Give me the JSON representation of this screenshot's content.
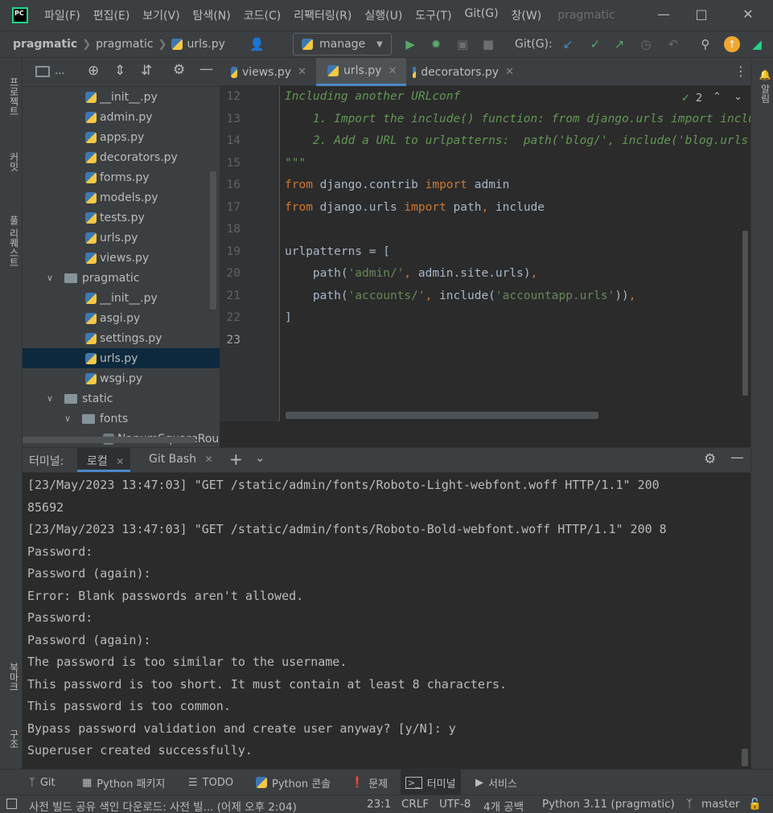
{
  "app": {
    "logo": "PC",
    "menu": [
      "파일(F)",
      "편집(E)",
      "보기(V)",
      "탐색(N)",
      "코드(C)",
      "리팩터링(R)",
      "실행(U)",
      "도구(T)",
      "Git(G)",
      "창(W)"
    ],
    "window_title": "pragmatic"
  },
  "navbar": {
    "crumbs": [
      "pragmatic",
      "pragmatic",
      "urls.py"
    ],
    "run_config": "manage",
    "git_label": "Git(G):"
  },
  "left_strip": {
    "project": "프로젝트",
    "commit": "커밋",
    "pull_requests": "풀 리퀘스트",
    "bookmarks": "북마크",
    "structure": "구조"
  },
  "right_strip": {
    "notifications": "알림"
  },
  "project_tree": {
    "toolbar_label": "...",
    "rows": [
      {
        "label": "__init__.py",
        "type": "py",
        "indent": 1
      },
      {
        "label": "admin.py",
        "type": "py",
        "indent": 1
      },
      {
        "label": "apps.py",
        "type": "py",
        "indent": 1
      },
      {
        "label": "decorators.py",
        "type": "py",
        "indent": 1
      },
      {
        "label": "forms.py",
        "type": "py",
        "indent": 1
      },
      {
        "label": "models.py",
        "type": "py",
        "indent": 1
      },
      {
        "label": "tests.py",
        "type": "py",
        "indent": 1
      },
      {
        "label": "urls.py",
        "type": "py",
        "indent": 1
      },
      {
        "label": "views.py",
        "type": "py",
        "indent": 1
      },
      {
        "label": "pragmatic",
        "type": "folder",
        "indent": 0
      },
      {
        "label": "__init__.py",
        "type": "py",
        "indent": 1
      },
      {
        "label": "asgi.py",
        "type": "py",
        "indent": 1
      },
      {
        "label": "settings.py",
        "type": "py",
        "indent": 1
      },
      {
        "label": "urls.py",
        "type": "py",
        "indent": 1,
        "selected": true
      },
      {
        "label": "wsgi.py",
        "type": "py",
        "indent": 1
      },
      {
        "label": "static",
        "type": "folder",
        "indent": 0
      },
      {
        "label": "fonts",
        "type": "folder",
        "indent": 1
      },
      {
        "label": "NanumSquareRou",
        "type": "file",
        "indent": 2
      }
    ]
  },
  "editor": {
    "tabs": [
      {
        "label": "views.py",
        "active": false
      },
      {
        "label": "urls.py",
        "active": true
      },
      {
        "label": "decorators.py",
        "active": false
      }
    ],
    "inspection_count": "2",
    "line_numbers": [
      "12",
      "13",
      "14",
      "15",
      "16",
      "17",
      "18",
      "19",
      "20",
      "21",
      "22",
      "23"
    ]
  },
  "terminal": {
    "title": "터미널:",
    "tabs": [
      "로컬",
      "Git Bash"
    ],
    "lines": [
      "[23/May/2023 13:47:03] \"GET /static/admin/fonts/Roboto-Light-webfont.woff HTTP/1.1\" 200",
      "85692",
      "[23/May/2023 13:47:03] \"GET /static/admin/fonts/Roboto-Bold-webfont.woff HTTP/1.1\" 200 8",
      "Password:",
      "Password (again):",
      "Error: Blank passwords aren't allowed.",
      "Password:",
      "Password (again):",
      "The password is too similar to the username.",
      "This password is too short. It must contain at least 8 characters.",
      "This password is too common.",
      "Bypass password validation and create user anyway? [y/N]: y",
      "Superuser created successfully."
    ]
  },
  "bottom_tools": [
    "Git",
    "Python 패키지",
    "TODO",
    "Python 콘솔",
    "문제",
    "터미널",
    "서비스"
  ],
  "status": {
    "message": "사전 빌드 공유 색인 다운로드: 사전 빌... (어제 오후 2:04)",
    "position": "23:1",
    "line_sep": "CRLF",
    "encoding": "UTF-8",
    "indent": "4개 공백",
    "interpreter": "Python 3.11 (pragmatic)",
    "branch": "master"
  }
}
